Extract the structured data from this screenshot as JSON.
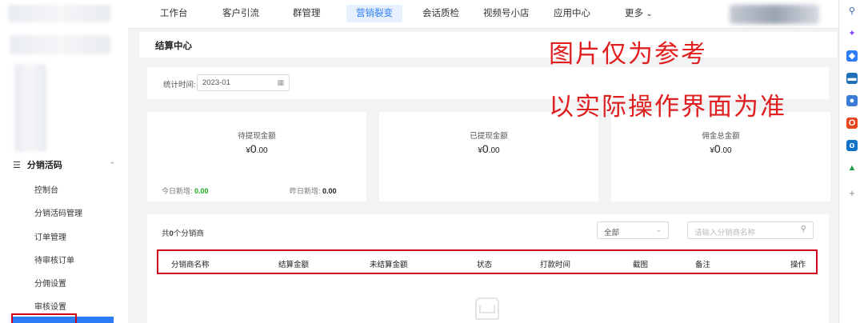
{
  "nav": {
    "items": [
      "工作台",
      "客户引流",
      "群管理",
      "营销裂变",
      "会话质检",
      "视频号小店",
      "应用中心",
      "更多"
    ],
    "active": "营销裂变",
    "more_arrow": "⌄"
  },
  "sidebar": {
    "group_label": "分销活码",
    "group_icon": "menu-lines-icon",
    "items": [
      "控制台",
      "分销活码管理",
      "订单管理",
      "待审核订单",
      "分佣设置",
      "审核设置"
    ]
  },
  "breadcrumb": {
    "title": "结算中心"
  },
  "filter": {
    "label": "统计时间:",
    "date_value": "2023-01"
  },
  "stats": [
    {
      "title": "待提现金额",
      "currency": "¥",
      "int": "0",
      "dec": ".00"
    },
    {
      "title": "已提现金额",
      "currency": "¥",
      "int": "0",
      "dec": ".00"
    },
    {
      "title": "佣金总金额",
      "currency": "¥",
      "int": "0",
      "dec": ".00"
    }
  ],
  "stat_footer": {
    "today_label": "今日新增:",
    "today_value": "0.00",
    "yesterday_label": "昨日新增:",
    "yesterday_value": "0.00"
  },
  "list": {
    "count_prefix": "共",
    "count_value": "0",
    "count_suffix": "个分销商",
    "select_value": "全部",
    "search_placeholder": "请输入分销商名称",
    "columns": [
      "分销商名称",
      "结算金额",
      "未结算金额",
      "状态",
      "打款时间",
      "截图",
      "备注",
      "操作"
    ]
  },
  "watermark": {
    "line1": "图片仅为参考",
    "line2": "以实际操作界面为准"
  },
  "colors": {
    "accent": "#2b7cf6",
    "highlight_red": "#d0021b",
    "watermark_red": "#e02020",
    "positive_green": "#1aad19"
  }
}
